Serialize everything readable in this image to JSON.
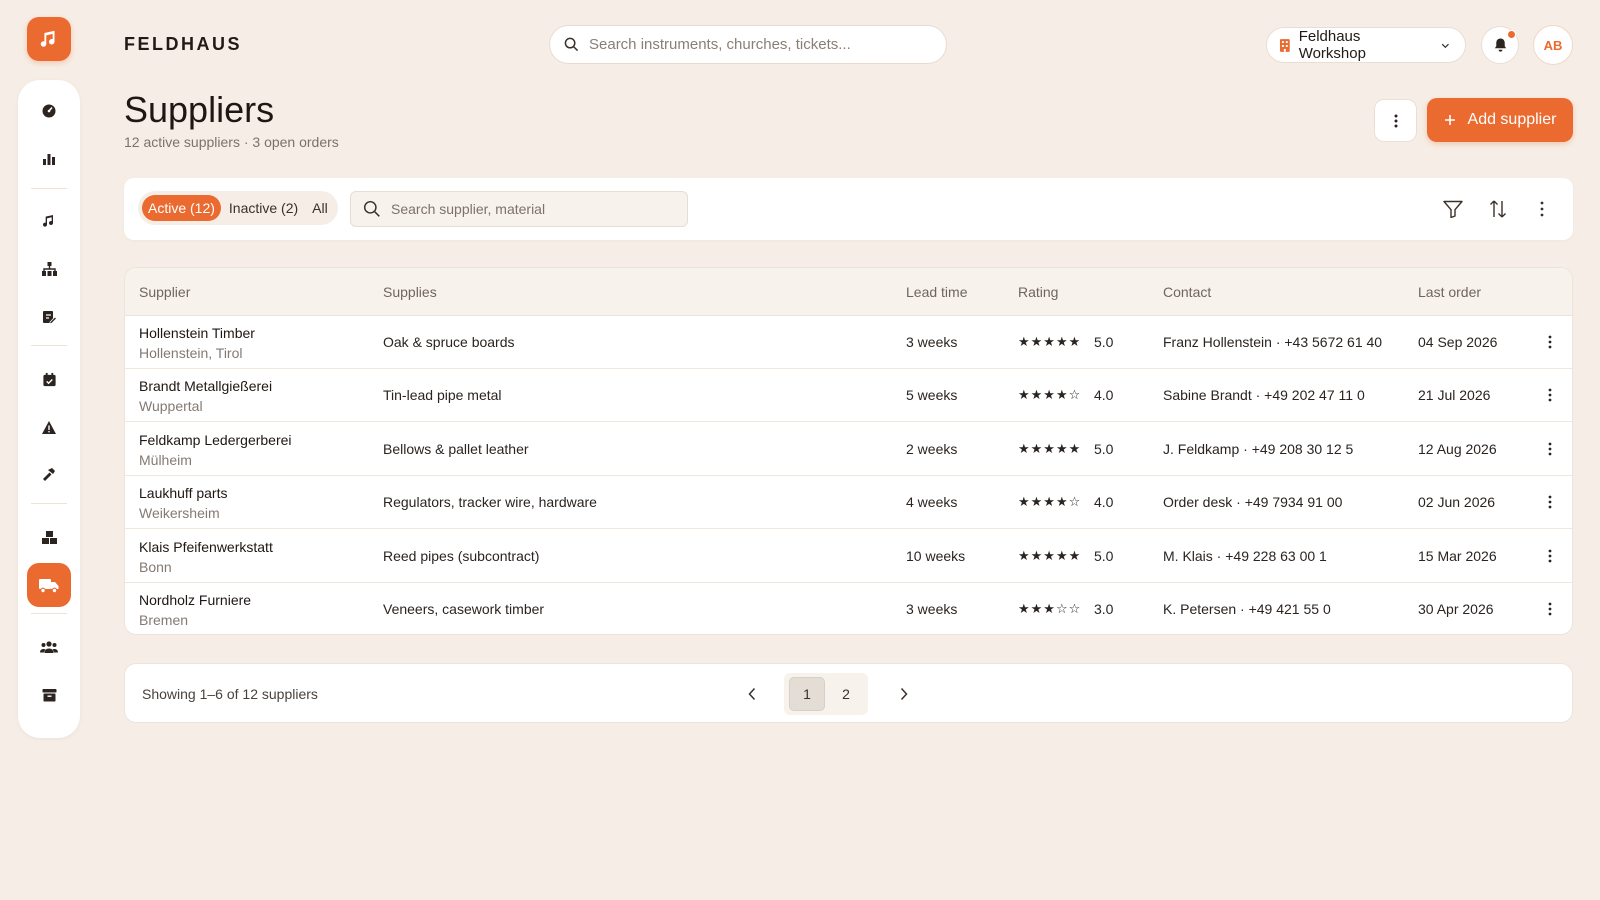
{
  "app": {
    "brand": "FELDHAUS"
  },
  "header": {
    "search_placeholder": "Search instruments, churches, tickets...",
    "workspace": "Feldhaus Workshop",
    "avatar_initials": "AB"
  },
  "sidebar": {
    "items": [
      {
        "icon": "dashboard-icon"
      },
      {
        "icon": "bar-chart-icon"
      },
      {
        "icon": "music-note-icon"
      },
      {
        "icon": "organization-icon"
      },
      {
        "icon": "document-edit-icon"
      },
      {
        "icon": "calendar-icon"
      },
      {
        "icon": "warning-icon"
      },
      {
        "icon": "hammer-icon"
      },
      {
        "icon": "inventory-boxes-icon"
      },
      {
        "icon": "truck-icon",
        "active": true
      },
      {
        "icon": "users-icon"
      },
      {
        "icon": "archive-icon"
      }
    ]
  },
  "page": {
    "title": "Suppliers",
    "subtitle": "12 active suppliers · 3 open orders",
    "add_label": "Add supplier"
  },
  "filters": {
    "tabs": [
      "Active (12)",
      "Inactive (2)",
      "All"
    ],
    "search_placeholder": "Search supplier, material"
  },
  "table": {
    "columns": [
      "Supplier",
      "Supplies",
      "Lead time",
      "Rating",
      "Contact",
      "Last order"
    ],
    "rows": [
      {
        "name": "Hollenstein Timber",
        "location": "Hollenstein, Tirol",
        "supplies": "Oak & spruce boards",
        "lead": "3 weeks",
        "stars": "★★★★★",
        "rating": "5.0",
        "contact": "Franz Hollenstein · +43 5672 61 40",
        "last": "04 Sep 2026"
      },
      {
        "name": "Brandt Metallgießerei",
        "location": "Wuppertal",
        "supplies": "Tin-lead pipe metal",
        "lead": "5 weeks",
        "stars": "★★★★☆",
        "rating": "4.0",
        "contact": "Sabine Brandt · +49 202 47 11 0",
        "last": "21 Jul 2026"
      },
      {
        "name": "Feldkamp Ledergerberei",
        "location": "Mülheim",
        "supplies": "Bellows & pallet leather",
        "lead": "2 weeks",
        "stars": "★★★★★",
        "rating": "5.0",
        "contact": "J. Feldkamp · +49 208 30 12 5",
        "last": "12 Aug 2026"
      },
      {
        "name": "Laukhuff parts",
        "location": "Weikersheim",
        "supplies": "Regulators, tracker wire, hardware",
        "lead": "4 weeks",
        "stars": "★★★★☆",
        "rating": "4.0",
        "contact": "Order desk · +49 7934 91 00",
        "last": "02 Jun 2026"
      },
      {
        "name": "Klais Pfeifenwerkstatt",
        "location": "Bonn",
        "supplies": "Reed pipes (subcontract)",
        "lead": "10 weeks",
        "stars": "★★★★★",
        "rating": "5.0",
        "contact": "M. Klais · +49 228 63 00 1",
        "last": "15 Mar 2026"
      },
      {
        "name": "Nordholz Furniere",
        "location": "Bremen",
        "supplies": "Veneers, casework timber",
        "lead": "3 weeks",
        "stars": "★★★☆☆",
        "rating": "3.0",
        "contact": "K. Petersen · +49 421 55 0",
        "last": "30 Apr 2026"
      }
    ]
  },
  "pagination": {
    "summary": "Showing 1–6 of 12 suppliers",
    "pages": [
      "1",
      "2"
    ],
    "current": "1"
  },
  "colors": {
    "accent": "#ea6a2f",
    "background": "#f6eee6"
  }
}
